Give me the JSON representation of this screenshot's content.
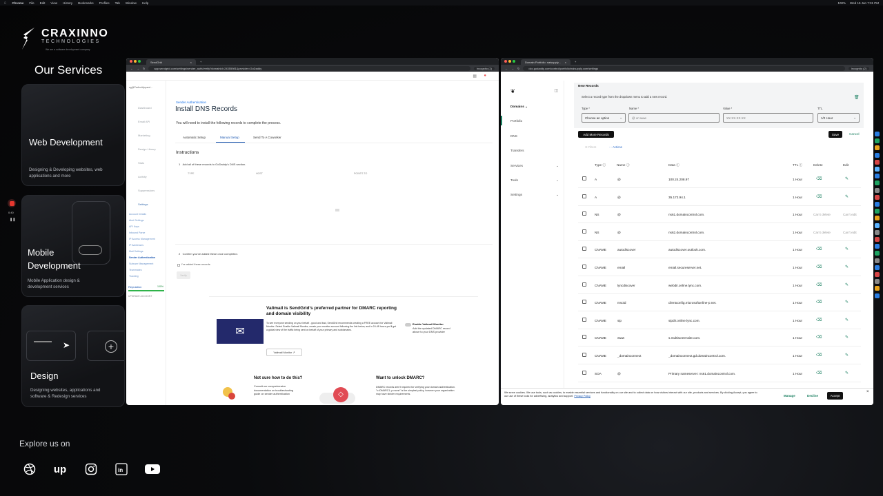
{
  "menubar": {
    "items": [
      "Chrome",
      "File",
      "Edit",
      "View",
      "History",
      "Bookmarks",
      "Profiles",
      "Tab",
      "Window",
      "Help"
    ],
    "clock": "Wed 15 Jan  7:31 PM",
    "battery": "100%"
  },
  "brand": {
    "name": "CRAXINNO",
    "sub": "TECHNOLOGIES",
    "tagline": "We are a software development company"
  },
  "services": {
    "title": "Our Services",
    "cards": [
      {
        "title": "Web Development",
        "desc": "Designing & Developing websites, web applications and more"
      },
      {
        "title": "Mobile Development",
        "desc": "Mobile Application design & development services"
      },
      {
        "title": "Design",
        "desc": "Designing websites, applications and software & Redesign services"
      }
    ]
  },
  "explore": {
    "label": "Explore us on",
    "icons": [
      "dribbble-icon",
      "upwork-icon",
      "instagram-icon",
      "linkedin-icon",
      "youtube-icon"
    ]
  },
  "recorder": {
    "time": "0:40"
  },
  "win1": {
    "tab": "SendGrid",
    "url": "app.sendgrid.com/settings/sender_auth/verify?domainId=24355981&provider=GoDaddy",
    "incognito": "Incognito (2)",
    "account": "sg@ParfectApparel...",
    "nav": [
      "Dashboard",
      "Email API",
      "Marketing",
      "Design Library",
      "Stats",
      "Activity",
      "Suppressions",
      "Settings"
    ],
    "settings_sub": [
      "Account Details",
      "Alert Settings",
      "API Keys",
      "Inbound Parse",
      "IP Access Management",
      "IP Addresses",
      "Mail Settings",
      "Sender Authentication",
      "Subuser Management",
      "Teammates",
      "Tracking"
    ],
    "reputation": "Reputation",
    "reputation_value": "100%",
    "upgrade": "UPGRADE ACCOUNT",
    "crumb": "Sender Authentication",
    "heading": "Install DNS Records",
    "intro": "You will need to install the following records to complete the process.",
    "tabs": [
      "Automatic Setup",
      "Manual Setup",
      "Send To A Coworker"
    ],
    "instructions": "Instructions",
    "step1": "Add all of these records to GoDaddy's DNS section.",
    "cols": [
      "TYPE",
      "HOST",
      "POINTS TO"
    ],
    "step2": "Confirm you've added these once completed.",
    "checkbox": "I've added these records.",
    "verify": "Verify",
    "valimail_title": "Valimail is SendGrid's preferred partner for DMARC reporting and domain visibility",
    "valimail_body": "To see everyone sending on your behalf - good and bad, SendGrid recommends creating a FREE account for Valimail Monitor. Select Enable Valimail Monitor, create your monitor account following the link below, and in 24-48 hours you'll get a global view of the traffic being sent on behalf of your primary and subdomains.",
    "toggle": "Enable Valimail Monitor",
    "toggle_desc": "Add the updated DMARC record above to your DNS provider",
    "valimail_link": "Valimail Monitor",
    "help_title": "Not sure how to do this?",
    "help_body": "Consult our comprehensive documentation on troubleshooting guide on sender authentication",
    "dmarc_title": "Want to unlock DMARC?",
    "dmarc_body": "DMARC records aren't required for verifying your domain authentication. \"v=DMARC1; p=none\" is the simplest policy, however your organization may have stricter requirements."
  },
  "win2": {
    "tab": "Domain Portfolio: naisupply...",
    "url": "dcc.godaddy.com/control/portfolio/naisupply.com/settings",
    "incognito": "Incognito (2)",
    "nav": [
      "Domains",
      "Portfolio",
      "DNS",
      "Transfers",
      "Services",
      "Tools",
      "Settings"
    ],
    "new_records": "New Records",
    "new_desc": "Select a record type from the dropdown menu to add a new record.",
    "labels": [
      "Type *",
      "Name *",
      "Value *",
      "TTL"
    ],
    "type_ph": "Choose an option",
    "name_ph": "@ or www",
    "value_ph": "XX.XX.XX.XX",
    "ttl_val": "1/2 Hour",
    "add_more": "Add More Records",
    "save": "Save",
    "cancel": "Cancel",
    "filters": "Filters",
    "actions": "Actions",
    "cols": [
      "Type",
      "Name",
      "Data",
      "TTL",
      "Delete",
      "Edit"
    ],
    "rows": [
      {
        "type": "A",
        "name": "@",
        "data": "100.24.208.97",
        "ttl": "1 Hour",
        "del": "",
        "edit": ""
      },
      {
        "type": "A",
        "name": "@",
        "data": "35.172.94.1",
        "ttl": "1 Hour",
        "del": "",
        "edit": ""
      },
      {
        "type": "NS",
        "name": "@",
        "data": "ns61.domaincontrol.com.",
        "ttl": "1 Hour",
        "del": "Can't delete",
        "edit": "Can't edit"
      },
      {
        "type": "NS",
        "name": "@",
        "data": "ns62.domaincontrol.com.",
        "ttl": "1 Hour",
        "del": "Can't delete",
        "edit": "Can't edit"
      },
      {
        "type": "CNAME",
        "name": "autodiscover",
        "data": "autodiscover.outlook.com.",
        "ttl": "1 Hour",
        "del": "",
        "edit": ""
      },
      {
        "type": "CNAME",
        "name": "email",
        "data": "email.secureserver.net.",
        "ttl": "1 Hour",
        "del": "",
        "edit": ""
      },
      {
        "type": "CNAME",
        "name": "lyncdiscover",
        "data": "webdir.online.lync.com.",
        "ttl": "1 Hour",
        "del": "",
        "edit": ""
      },
      {
        "type": "CNAME",
        "name": "msoid",
        "data": "clientconfig.microsoftonline-p.net.",
        "ttl": "1 Hour",
        "del": "",
        "edit": ""
      },
      {
        "type": "CNAME",
        "name": "sip",
        "data": "sipdir.online.lync.com.",
        "ttl": "1 Hour",
        "del": "",
        "edit": ""
      },
      {
        "type": "CNAME",
        "name": "www",
        "data": "s.multiscreensite.com.",
        "ttl": "1 Hour",
        "del": "",
        "edit": ""
      },
      {
        "type": "CNAME",
        "name": "_domainconnect",
        "data": "_domainconnect.gd.domaincontrol.com.",
        "ttl": "1 Hour",
        "del": "",
        "edit": ""
      },
      {
        "type": "SOA",
        "name": "@",
        "data": "Primary nameserver: ns61.domaincontrol.com.",
        "ttl": "1 Hour",
        "del": "",
        "edit": ""
      }
    ],
    "cookie": "We serve cookies. We use tools, such as cookies, to enable essential services and functionality on our site and to collect data on how visitors interact with our site, products and services. By clicking Accept, you agree to our use of these tools for advertising, analytics and support.",
    "privacy": "Privacy Policy",
    "manage": "Manage",
    "decline": "Decline",
    "accept": "Accept"
  }
}
